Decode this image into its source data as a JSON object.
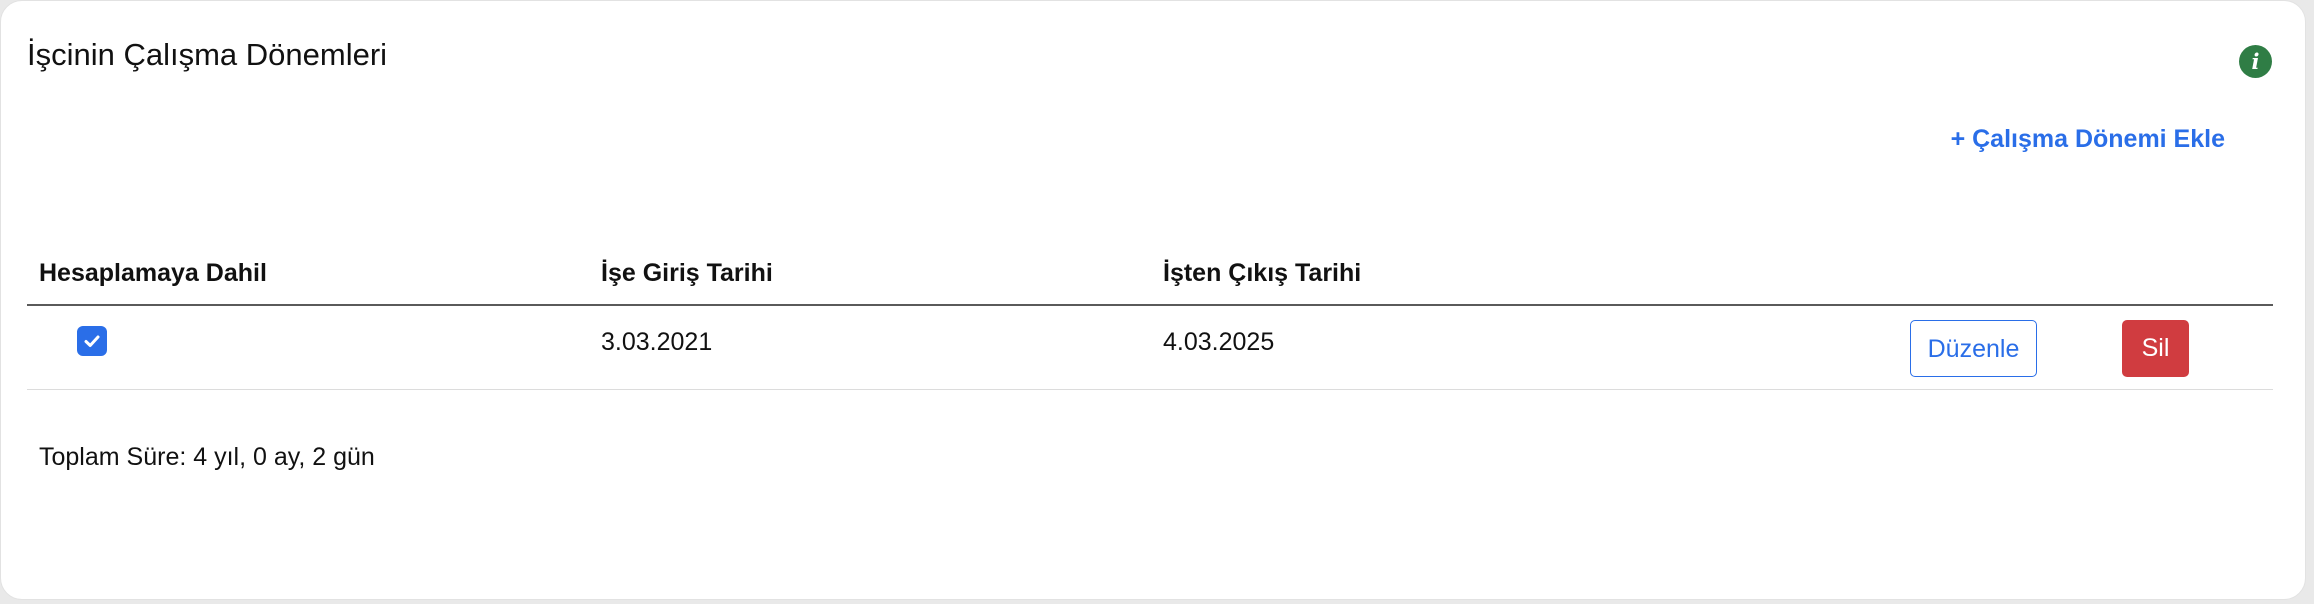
{
  "panel": {
    "title": "İşcinin Çalışma Dönemleri",
    "info_icon_glyph": "i",
    "add_link": "+ Çalışma Dönemi Ekle"
  },
  "table": {
    "headers": {
      "included": "Hesaplamaya Dahil",
      "start": "İşe Giriş Tarihi",
      "end": "İşten Çıkış Tarihi"
    },
    "rows": [
      {
        "included": true,
        "start": "3.03.2021",
        "end": "4.03.2025",
        "edit_label": "Düzenle",
        "delete_label": "Sil"
      }
    ]
  },
  "summary": {
    "total": "Toplam Süre: 4 yıl, 0 ay, 2 gün"
  },
  "colors": {
    "accent": "#2a6ee8",
    "danger": "#d03c40",
    "info": "#2f7d45"
  },
  "icons": [
    "info-icon",
    "check-icon"
  ]
}
